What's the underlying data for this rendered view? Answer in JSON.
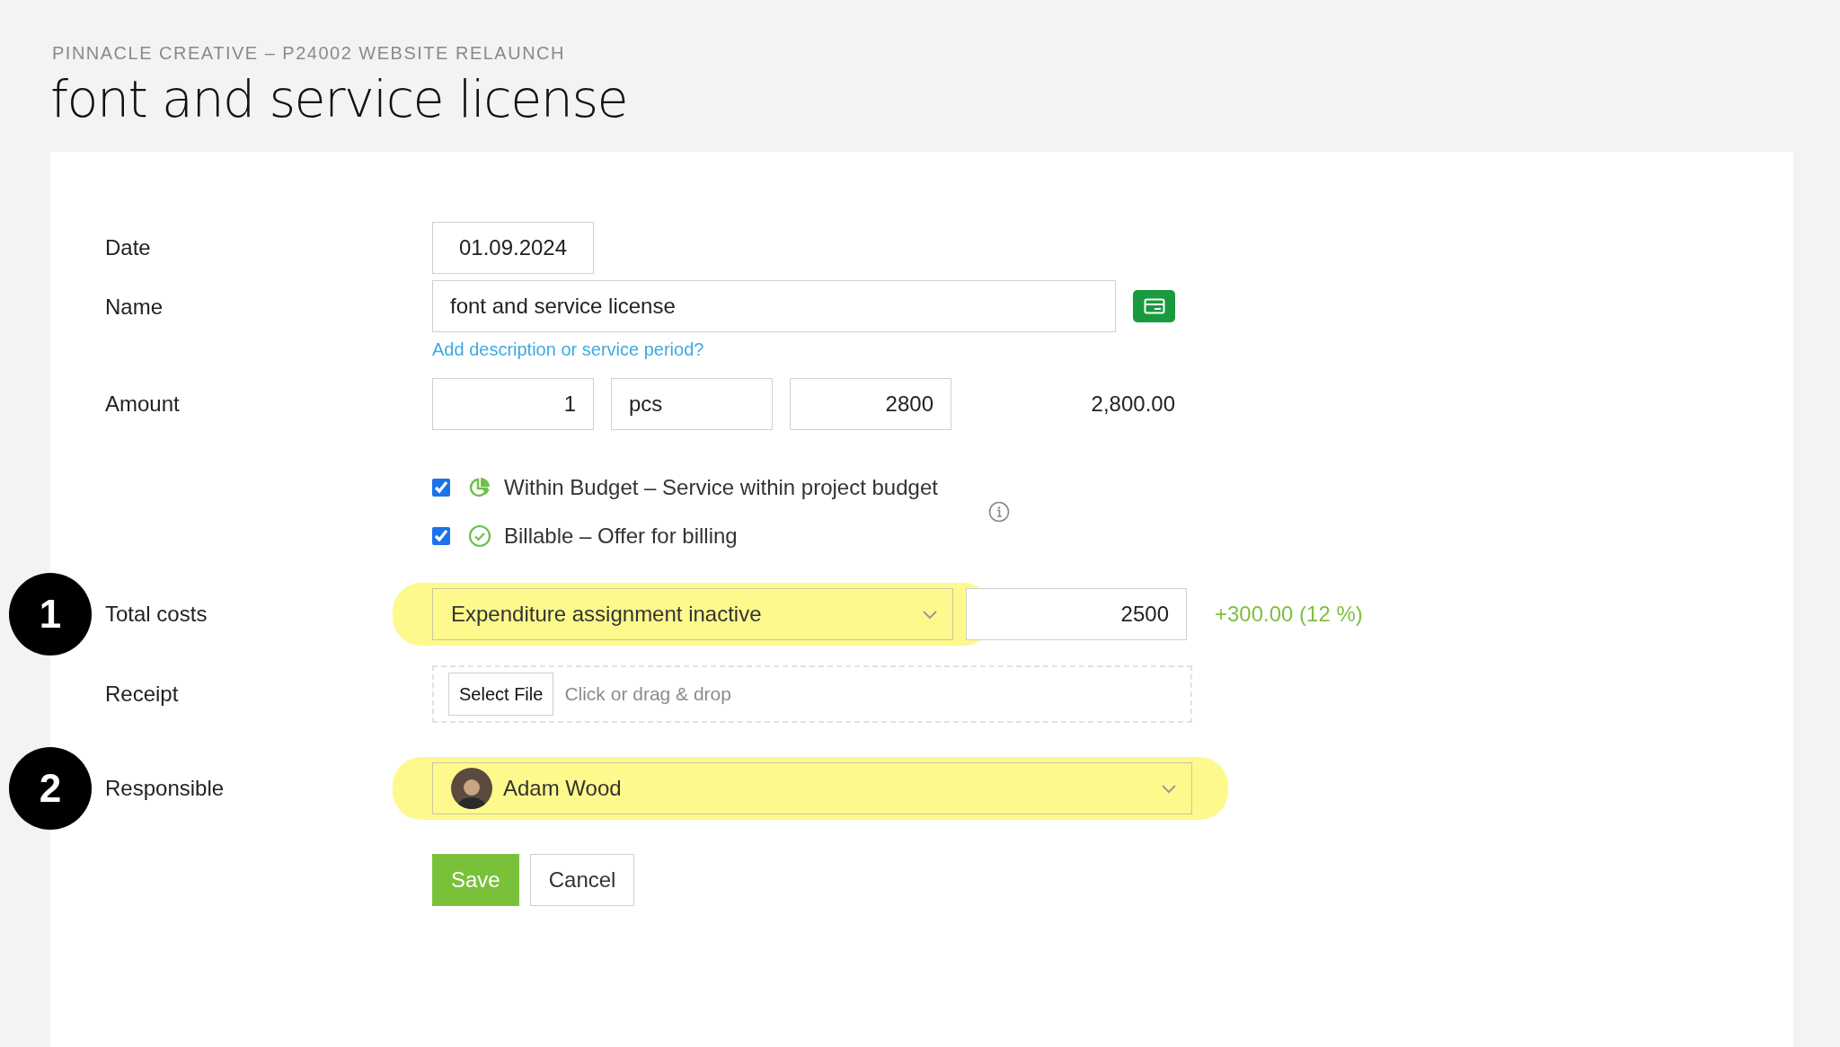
{
  "breadcrumb": "PINNACLE CREATIVE – P24002 WEBSITE RELAUNCH",
  "title": "font and service license",
  "form": {
    "date": {
      "label": "Date",
      "value": "01.09.2024"
    },
    "name": {
      "label": "Name",
      "value": "font and service license",
      "link": "Add description or service period?"
    },
    "amount": {
      "label": "Amount",
      "quantity": "1",
      "unit": "pcs",
      "price": "2800",
      "total": "2,800.00"
    },
    "options": [
      {
        "kind": "budget",
        "label": "Within Budget – Service within project budget",
        "checked": true
      },
      {
        "kind": "billable",
        "label": "Billable – Offer for billing",
        "checked": true
      }
    ],
    "total_costs": {
      "label": "Total costs",
      "marker": "1",
      "assignment": "Expenditure assignment inactive",
      "highlighted": true,
      "value": "2500",
      "difference": "+300.00 (12 %)"
    },
    "receipt": {
      "label": "Receipt",
      "button": "Select File",
      "placeholder": "Click or drag & drop"
    },
    "responsible": {
      "label": "Responsible",
      "marker": "2",
      "person": "Adam Wood",
      "highlighted": true
    }
  },
  "buttons": [
    {
      "kind": "primary",
      "label": "Save"
    },
    {
      "kind": "secondary",
      "label": "Cancel"
    }
  ]
}
